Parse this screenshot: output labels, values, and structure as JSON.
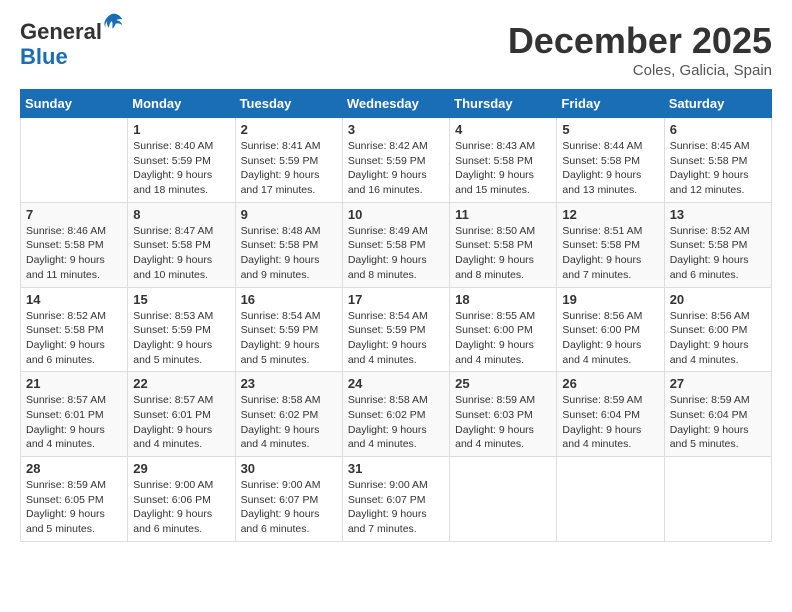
{
  "logo": {
    "general": "General",
    "blue": "Blue"
  },
  "header": {
    "month": "December 2025",
    "location": "Coles, Galicia, Spain"
  },
  "weekdays": [
    "Sunday",
    "Monday",
    "Tuesday",
    "Wednesday",
    "Thursday",
    "Friday",
    "Saturday"
  ],
  "weeks": [
    [
      {
        "day": "",
        "info": ""
      },
      {
        "day": "1",
        "info": "Sunrise: 8:40 AM\nSunset: 5:59 PM\nDaylight: 9 hours\nand 18 minutes."
      },
      {
        "day": "2",
        "info": "Sunrise: 8:41 AM\nSunset: 5:59 PM\nDaylight: 9 hours\nand 17 minutes."
      },
      {
        "day": "3",
        "info": "Sunrise: 8:42 AM\nSunset: 5:59 PM\nDaylight: 9 hours\nand 16 minutes."
      },
      {
        "day": "4",
        "info": "Sunrise: 8:43 AM\nSunset: 5:58 PM\nDaylight: 9 hours\nand 15 minutes."
      },
      {
        "day": "5",
        "info": "Sunrise: 8:44 AM\nSunset: 5:58 PM\nDaylight: 9 hours\nand 13 minutes."
      },
      {
        "day": "6",
        "info": "Sunrise: 8:45 AM\nSunset: 5:58 PM\nDaylight: 9 hours\nand 12 minutes."
      }
    ],
    [
      {
        "day": "7",
        "info": "Sunrise: 8:46 AM\nSunset: 5:58 PM\nDaylight: 9 hours\nand 11 minutes."
      },
      {
        "day": "8",
        "info": "Sunrise: 8:47 AM\nSunset: 5:58 PM\nDaylight: 9 hours\nand 10 minutes."
      },
      {
        "day": "9",
        "info": "Sunrise: 8:48 AM\nSunset: 5:58 PM\nDaylight: 9 hours\nand 9 minutes."
      },
      {
        "day": "10",
        "info": "Sunrise: 8:49 AM\nSunset: 5:58 PM\nDaylight: 9 hours\nand 8 minutes."
      },
      {
        "day": "11",
        "info": "Sunrise: 8:50 AM\nSunset: 5:58 PM\nDaylight: 9 hours\nand 8 minutes."
      },
      {
        "day": "12",
        "info": "Sunrise: 8:51 AM\nSunset: 5:58 PM\nDaylight: 9 hours\nand 7 minutes."
      },
      {
        "day": "13",
        "info": "Sunrise: 8:52 AM\nSunset: 5:58 PM\nDaylight: 9 hours\nand 6 minutes."
      }
    ],
    [
      {
        "day": "14",
        "info": "Sunrise: 8:52 AM\nSunset: 5:58 PM\nDaylight: 9 hours\nand 6 minutes."
      },
      {
        "day": "15",
        "info": "Sunrise: 8:53 AM\nSunset: 5:59 PM\nDaylight: 9 hours\nand 5 minutes."
      },
      {
        "day": "16",
        "info": "Sunrise: 8:54 AM\nSunset: 5:59 PM\nDaylight: 9 hours\nand 5 minutes."
      },
      {
        "day": "17",
        "info": "Sunrise: 8:54 AM\nSunset: 5:59 PM\nDaylight: 9 hours\nand 4 minutes."
      },
      {
        "day": "18",
        "info": "Sunrise: 8:55 AM\nSunset: 6:00 PM\nDaylight: 9 hours\nand 4 minutes."
      },
      {
        "day": "19",
        "info": "Sunrise: 8:56 AM\nSunset: 6:00 PM\nDaylight: 9 hours\nand 4 minutes."
      },
      {
        "day": "20",
        "info": "Sunrise: 8:56 AM\nSunset: 6:00 PM\nDaylight: 9 hours\nand 4 minutes."
      }
    ],
    [
      {
        "day": "21",
        "info": "Sunrise: 8:57 AM\nSunset: 6:01 PM\nDaylight: 9 hours\nand 4 minutes."
      },
      {
        "day": "22",
        "info": "Sunrise: 8:57 AM\nSunset: 6:01 PM\nDaylight: 9 hours\nand 4 minutes."
      },
      {
        "day": "23",
        "info": "Sunrise: 8:58 AM\nSunset: 6:02 PM\nDaylight: 9 hours\nand 4 minutes."
      },
      {
        "day": "24",
        "info": "Sunrise: 8:58 AM\nSunset: 6:02 PM\nDaylight: 9 hours\nand 4 minutes."
      },
      {
        "day": "25",
        "info": "Sunrise: 8:59 AM\nSunset: 6:03 PM\nDaylight: 9 hours\nand 4 minutes."
      },
      {
        "day": "26",
        "info": "Sunrise: 8:59 AM\nSunset: 6:04 PM\nDaylight: 9 hours\nand 4 minutes."
      },
      {
        "day": "27",
        "info": "Sunrise: 8:59 AM\nSunset: 6:04 PM\nDaylight: 9 hours\nand 5 minutes."
      }
    ],
    [
      {
        "day": "28",
        "info": "Sunrise: 8:59 AM\nSunset: 6:05 PM\nDaylight: 9 hours\nand 5 minutes."
      },
      {
        "day": "29",
        "info": "Sunrise: 9:00 AM\nSunset: 6:06 PM\nDaylight: 9 hours\nand 6 minutes."
      },
      {
        "day": "30",
        "info": "Sunrise: 9:00 AM\nSunset: 6:07 PM\nDaylight: 9 hours\nand 6 minutes."
      },
      {
        "day": "31",
        "info": "Sunrise: 9:00 AM\nSunset: 6:07 PM\nDaylight: 9 hours\nand 7 minutes."
      },
      {
        "day": "",
        "info": ""
      },
      {
        "day": "",
        "info": ""
      },
      {
        "day": "",
        "info": ""
      }
    ]
  ]
}
